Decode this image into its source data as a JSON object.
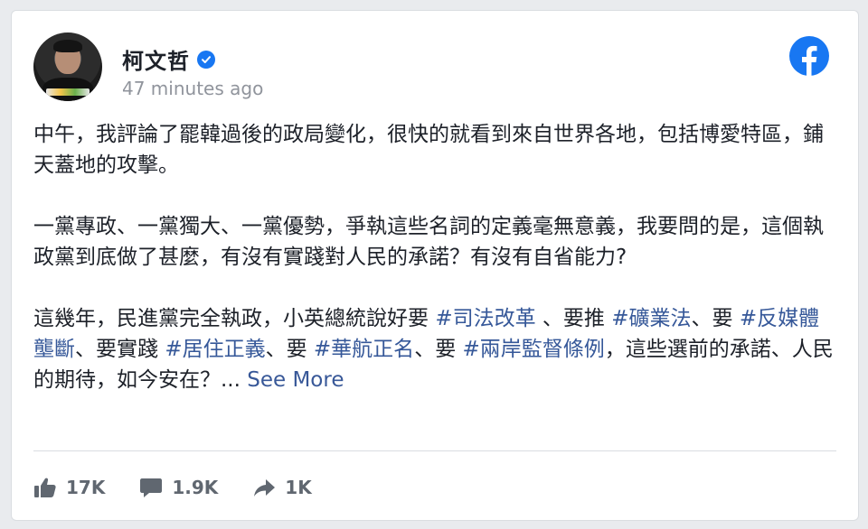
{
  "post": {
    "author": "柯文哲",
    "timestamp": "47 minutes ago",
    "paragraphs": {
      "p1": "中午，我評論了罷韓過後的政局變化，很快的就看到來自世界各地，包括博愛特區，鋪天蓋地的攻擊。",
      "p2": "一黨專政、一黨獨大、一黨優勢，爭執這些名詞的定義毫無意義，我要問的是，這個執政黨到底做了甚麼，有沒有實踐對人民的承諾？有沒有自省能力?"
    },
    "p3": {
      "t1": "這幾年，民進黨完全執政，小英總統說好要 ",
      "tag1": "#司法改革",
      "t2": " 、要推 ",
      "tag2": "#礦業法",
      "t3": "、要 ",
      "tag3": "#反媒體壟斷",
      "t4": "、要實踐 ",
      "tag4": "#居住正義",
      "t5": "、要 ",
      "tag5": "#華航正名",
      "t6": "、要 ",
      "tag6": "#兩岸監督條例",
      "t7": "，這些選前的承諾、人民的期待，如今安在？... ",
      "see_more": "See More"
    }
  },
  "stats": {
    "likes": "17K",
    "comments": "1.9K",
    "shares": "1K"
  },
  "colors": {
    "brand": "#1877f2",
    "hashtag": "#365899",
    "muted": "#606770"
  },
  "icons": [
    "verified-badge-icon",
    "facebook-logo-icon",
    "like-icon",
    "comment-icon",
    "share-icon"
  ]
}
